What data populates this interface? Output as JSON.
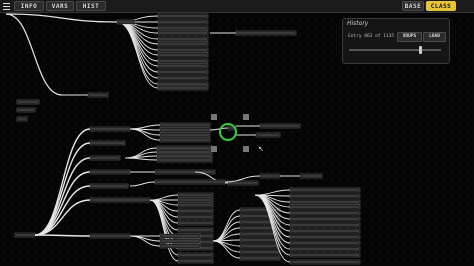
{
  "toolbar": {
    "info_label": "INFO",
    "vars_label": "VARS",
    "hist_label": "HIST",
    "base_label": "BASE",
    "class_label": "CLASS",
    "active_tab": "CLASS"
  },
  "history": {
    "title": "History",
    "entry_text": "Entry 863 of 1135",
    "xdups_label": "XDUPS",
    "load_label": "LOAD",
    "position": 0.76
  },
  "colors": {
    "accent": "#e8c43a",
    "selection_ring": "#35d13c",
    "edge": "#e6e6e6",
    "background": "#050505"
  },
  "icons": {
    "menu": "hamburger-menu-icon",
    "cursor": "mouse-pointer-icon"
  }
}
